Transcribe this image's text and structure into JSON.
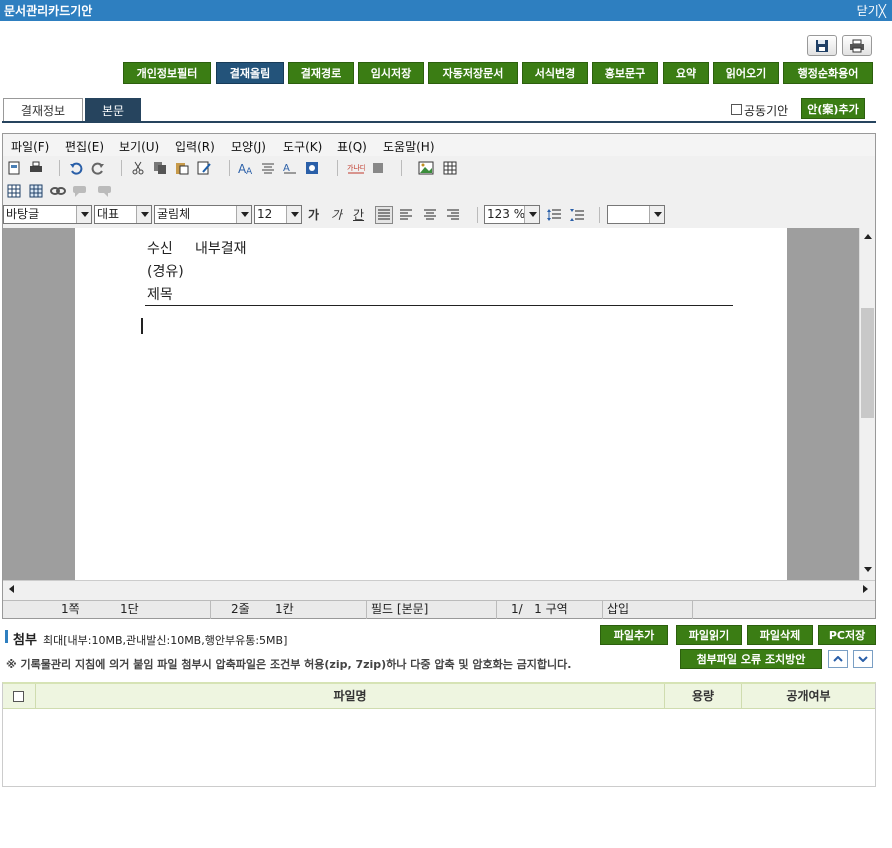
{
  "window": {
    "title": "문서관리카드기안",
    "close_label": "닫기"
  },
  "icons": {
    "save": "save-icon",
    "print": "print-icon"
  },
  "action_buttons": [
    "개인정보필터",
    "결재올림",
    "결재경로",
    "임시저장",
    "자동저장문서",
    "서식변경",
    "홍보문구",
    "요약",
    "읽어오기",
    "행정순화용어"
  ],
  "tabs": [
    {
      "label": "결재정보",
      "active": false
    },
    {
      "label": "본문",
      "active": true
    }
  ],
  "joint_draft": {
    "label": "공동기안",
    "checked": false
  },
  "add_plan_button": "안(案)추가",
  "menu": [
    "파일(F)",
    "편집(E)",
    "보기(U)",
    "입력(R)",
    "모양(J)",
    "도구(K)",
    "표(Q)",
    "도움말(H)"
  ],
  "format_bar": {
    "style": "바탕글",
    "lang": "대표",
    "font": "굴림체",
    "size": "12",
    "bold": "가",
    "italic": "가",
    "underline": "간",
    "zoom": "123 %",
    "extra": ""
  },
  "document": {
    "recipient_label": "수신",
    "recipient_value": "내부결재",
    "via_label": "(경유)",
    "subject_label": "제목"
  },
  "status": {
    "page": "1쪽",
    "column": "1단",
    "line": "2줄",
    "char": "1칸",
    "field": "필드 [본문]",
    "section": "1/   1 구역",
    "mode": "삽입"
  },
  "attachment": {
    "title": "첨부",
    "limit": "최대[내부:10MB,관내발신:10MB,행안부유통:5MB]",
    "notice": "※ 기록물관리 지침에 의거 붙임 파일 첨부시 압축파일은 조건부 허용(zip, 7zip)하나 다중 압축 및 암호화는 금지합니다.",
    "buttons": [
      "파일추가",
      "파일읽기",
      "파일삭제",
      "PC저장"
    ],
    "error_button": "첨부파일 오류 조치방안"
  },
  "file_table": {
    "columns": [
      "파일명",
      "용량",
      "공개여부"
    ]
  },
  "colors": {
    "title_bar": "#2e7fc0",
    "green_button": "#3b7d14",
    "blue_button": "#23537a",
    "tab_active": "#26445e"
  }
}
